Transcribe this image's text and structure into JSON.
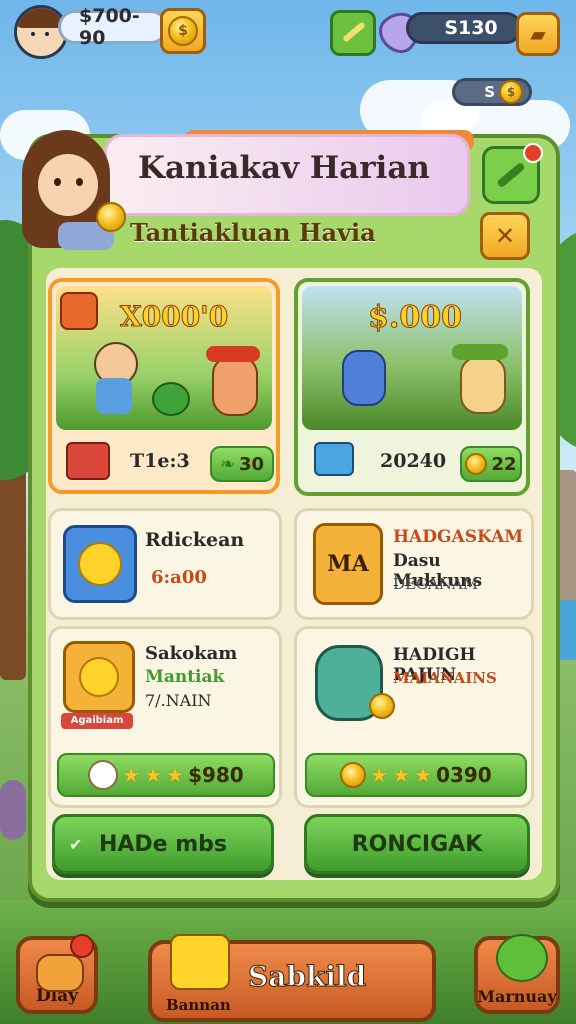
{
  "hud": {
    "gold": "$700-90",
    "gems": "S130",
    "small_counter": "S",
    "coin_glyph": "$"
  },
  "panel": {
    "title": "Kaniakav Harian",
    "subtitle": "Tantiakluan Havia",
    "close_glyph": "✕"
  },
  "featured": [
    {
      "price": "X000'0",
      "label": "T1e:3",
      "reward": "30"
    },
    {
      "price": "$.000",
      "label": "20240",
      "reward": "22"
    }
  ],
  "tasks": [
    {
      "title": "Rdickean",
      "detail": "6:a00"
    },
    {
      "title": "HADGASKAM",
      "line2": "Dasu Mukkuns",
      "line3": "DEGANAM",
      "badge": "MA"
    },
    {
      "title": "Sakokam",
      "line2": "Mantiak",
      "line3": "7/.NAIN",
      "banner": "Agaibiam"
    },
    {
      "title": "HADIGH PAJUN",
      "line2": "MAIANAINS"
    }
  ],
  "rewards": [
    {
      "value": "$980"
    },
    {
      "value": "0390"
    }
  ],
  "buttons": {
    "left": "HADe mbs",
    "right": "RONCIGAK"
  },
  "bottom_nav": {
    "left": "Dlay",
    "center": "Sabkild",
    "center_sub": "Bannan",
    "right": "Marnuay"
  },
  "colors": {
    "accent_green": "#4aa832",
    "panel_green": "#a7d86b",
    "gold": "#f5c021",
    "nav_orange": "#e0773a"
  }
}
